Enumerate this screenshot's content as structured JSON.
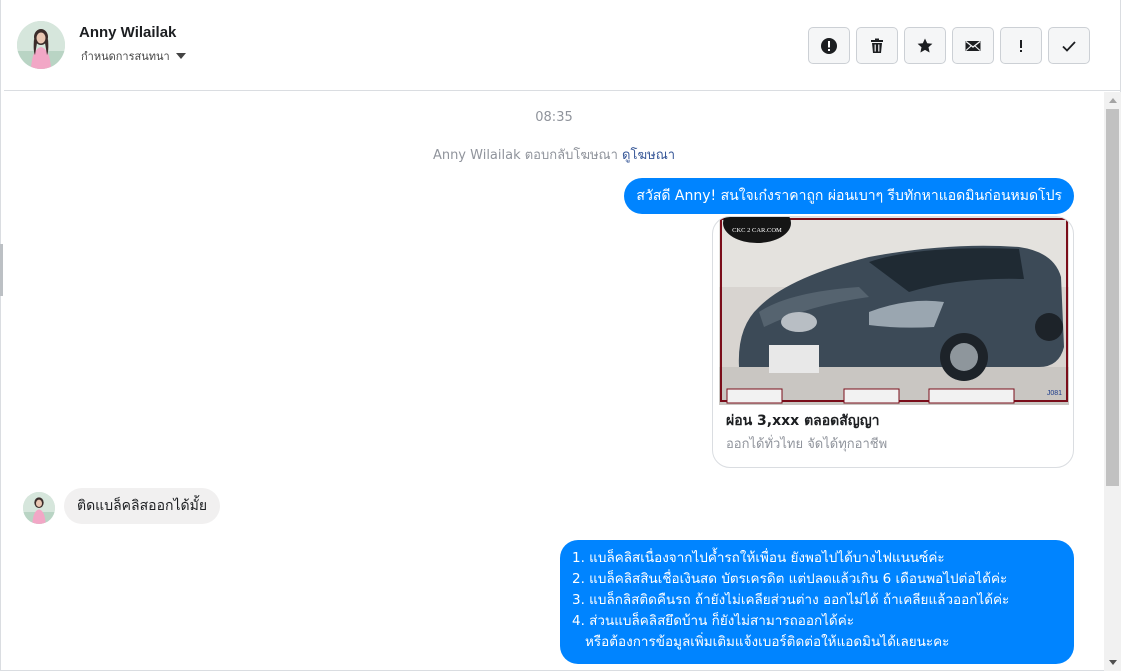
{
  "header": {
    "name": "Anny Wilailak",
    "subtitle": "กำหนดการสนทนา",
    "actions": [
      {
        "icon": "alert-circle-icon",
        "name": "report-button"
      },
      {
        "icon": "trash-icon",
        "name": "delete-button"
      },
      {
        "icon": "star-icon",
        "name": "star-button"
      },
      {
        "icon": "envelope-icon",
        "name": "mark-unread-button"
      },
      {
        "icon": "exclamation-icon",
        "name": "mark-important-button"
      },
      {
        "icon": "checkmark-icon",
        "name": "mark-done-button"
      }
    ]
  },
  "chat": {
    "timestamp": "08:35",
    "system_message": {
      "text": "Anny Wilailak ตอบกลับโฆษณา",
      "link": "ดูโฆษณา"
    },
    "outgoing_1": "สวัสดี Anny! สนใจเก๋งราคาถูก ผ่อนเบาๆ รีบทักหาแอดมินก่อนหมดโปร",
    "ad_card": {
      "logo_text": "CKC 2 CAR.COM",
      "image_code": "J081",
      "title": "ผ่อน 3,xxx ตลอดสัญญา",
      "subtitle": "ออกได้ทั่วไทย จัดได้ทุกอาชีพ"
    },
    "incoming_1": "ติดแบล็คลิสออกได้มั้ย",
    "outgoing_2": {
      "lines": [
        "1. แบล็คลิสเนื่องจากไปค้ำรถให้เพื่อน ยังพอไปได้บางไฟแนนซ์ค่ะ",
        "2. แบล็คลิสสินเชื่อเงินสด บัตรเครดิต แต่ปลดแล้วเกิน 6 เดือนพอไปต่อได้ค่ะ",
        "3. แบล็กลิสติดคืนรถ ถ้ายังไม่เคลียส่วนต่าง ออกไม่ได้ ถ้าเคลียแล้วออกได้ค่ะ",
        "4. ส่วนแบล็คลิสยึดบ้าน ก็ยังไม่สามารถออกได้ค่ะ",
        "หรือต้องการข้อมูลเพิ่มเติมแจ้งเบอร์ติดต่อให้แอดมินได้เลยนะคะ"
      ]
    }
  },
  "colors": {
    "outgoing_bubble": "#0084ff",
    "incoming_bubble": "#f1f0f0",
    "link": "#385898",
    "muted_text": "#90949c"
  }
}
